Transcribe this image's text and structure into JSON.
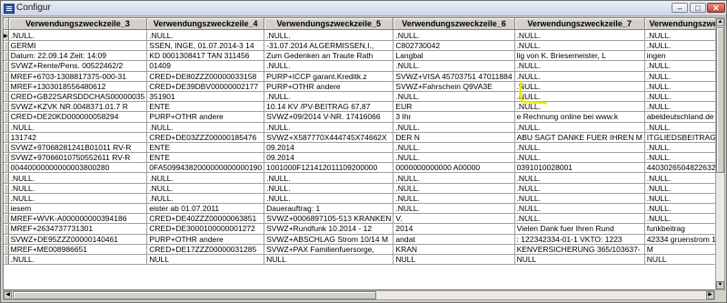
{
  "window": {
    "title": "Configur"
  },
  "grid": {
    "columns": [
      "Verwendungszweckzeile_3",
      "Verwendungszweckzeile_4",
      "Verwendungszweckzeile_5",
      "Verwendungszweckzeile_6",
      "Verwendungszweckzeile_7",
      "Verwendungszwe"
    ],
    "rows": [
      [
        ".NULL.",
        ".NULL.",
        ".NULL.",
        ".NULL.",
        ".NULL.",
        ".NULL."
      ],
      [
        "GERMI",
        "SSEN, INGE, 01.07.2014-3 14",
        "-31.07.2014 ALGERMISSEN,I.,",
        "C802730042",
        ".NULL.",
        ".NULL."
      ],
      [
        "Datum: 22.09.14 Zeit: 14:09",
        "KD 0001308417 TAN 311456",
        "Zum Gedenken an Traute Rath",
        "Langbal",
        "lig von K. Briesemeister, L",
        "ingen"
      ],
      [
        "SVWZ+Rente/Pens. 00522462/2",
        "01409",
        ".NULL.",
        ".NULL.",
        ".NULL.",
        ".NULL."
      ],
      [
        "MREF+6703-1308817375-000-31",
        "CRED+DE80ZZZ00000033158",
        "PURP+ICCP garant.Kreditk.z",
        "SVWZ+VISA 45703751 47011884",
        ".NULL.",
        ".NULL."
      ],
      [
        "MREF+1303018556480612",
        "CRED+DE39DBV00000002177",
        "PURP+OTHR andere",
        "SVWZ+Fahrschein Q9VA3E",
        ".NULL.",
        ".NULL."
      ],
      [
        "CRED+GB22SARSDDCHAS00000035",
        "351901",
        ".NULL.",
        ".NULL.",
        ".NULL.",
        ".NULL."
      ],
      [
        "SVWZ+KZVK NR.0048371.01.7 R",
        "ENTE",
        "10.14 KV /PV-BEITRAG 67,87",
        "EUR",
        ".NULL.",
        ".NULL."
      ],
      [
        "CRED+DE20KD000000058294",
        "PURP+OTHR andere",
        "SVWZ+09/2014 V-NR. 17416066",
        "3 Ihr",
        "e Rechnung online bei www.k",
        "abeldeutschland.de"
      ],
      [
        ".NULL.",
        ".NULL.",
        ".NULL.",
        ".NULL.",
        ".NULL.",
        ".NULL."
      ],
      [
        "131742",
        "CRED+DE03ZZZ00000185476",
        "SVWZ+X587770X444745X74662X",
        "DER N",
        "ABU SAGT DANKE FUER IHREN M",
        "ITGLIEDSBEITRAG"
      ],
      [
        "SVWZ+97068281241B01011 RV-R",
        "ENTE",
        "09.2014",
        ".NULL.",
        ".NULL.",
        ".NULL."
      ],
      [
        "SVWZ+97066010750552611 RV-R",
        "ENTE",
        "09.2014",
        ".NULL.",
        ".NULL.",
        ".NULL."
      ],
      [
        "00440000000000003800280",
        "0FA50994382000000000000190",
        "1001000F121412011109200000",
        "0000000000000          A00000",
        "0391010028001",
        "44030265048226324"
      ],
      [
        ".NULL.",
        ".NULL.",
        ".NULL.",
        ".NULL.",
        ".NULL.",
        ".NULL."
      ],
      [
        ".NULL.",
        ".NULL.",
        ".NULL.",
        ".NULL.",
        ".NULL.",
        ".NULL."
      ],
      [
        ".NULL.",
        ".NULL.",
        ".NULL.",
        ".NULL.",
        ".NULL.",
        ".NULL."
      ],
      [
        "iesem",
        "eister ab 01.07.2011",
        "Dauerauftrag:          1",
        ".NULL.",
        ".NULL.",
        ".NULL."
      ],
      [
        "MREF+WVK-A000000000394186",
        "CRED+DE40ZZZ00000063851",
        "SVWZ+0006897105-513 KRANKEN",
        "V.",
        ".NULL.",
        ".NULL."
      ],
      [
        "MREF+2634737731301",
        "CRED+DE3000100000001272",
        "SVWZ+Rundfunk 10.2014 - 12",
        "2014",
        "Vielen Dank fuer Ihren Rund",
        "funkbeitrag"
      ],
      [
        "SVWZ+DE95ZZZ00000140461",
        "PURP+OTHR andere",
        "SVWZ+ABSCHLAG Strom 10/14 M",
        "andat",
        ": 122342334-01-1 VKTO: 1223",
        "42334 gruenstrom 1"
      ],
      [
        "MREF+ME008986651",
        "CRED+DE17ZZZ00000031285",
        "SVWZ+PAX Familienfuersorge,",
        "KRAN",
        "KENVERSICHERUNG 365/103637-",
        "M"
      ],
      [
        ".NULL.",
        "NULL",
        "NULL",
        "NULL",
        "NULL",
        "NULL"
      ]
    ]
  },
  "highlight": {
    "color": "#f0e400"
  },
  "scrollbars": {
    "up": "▲",
    "down": "▼",
    "left": "◀",
    "right": "▶"
  }
}
